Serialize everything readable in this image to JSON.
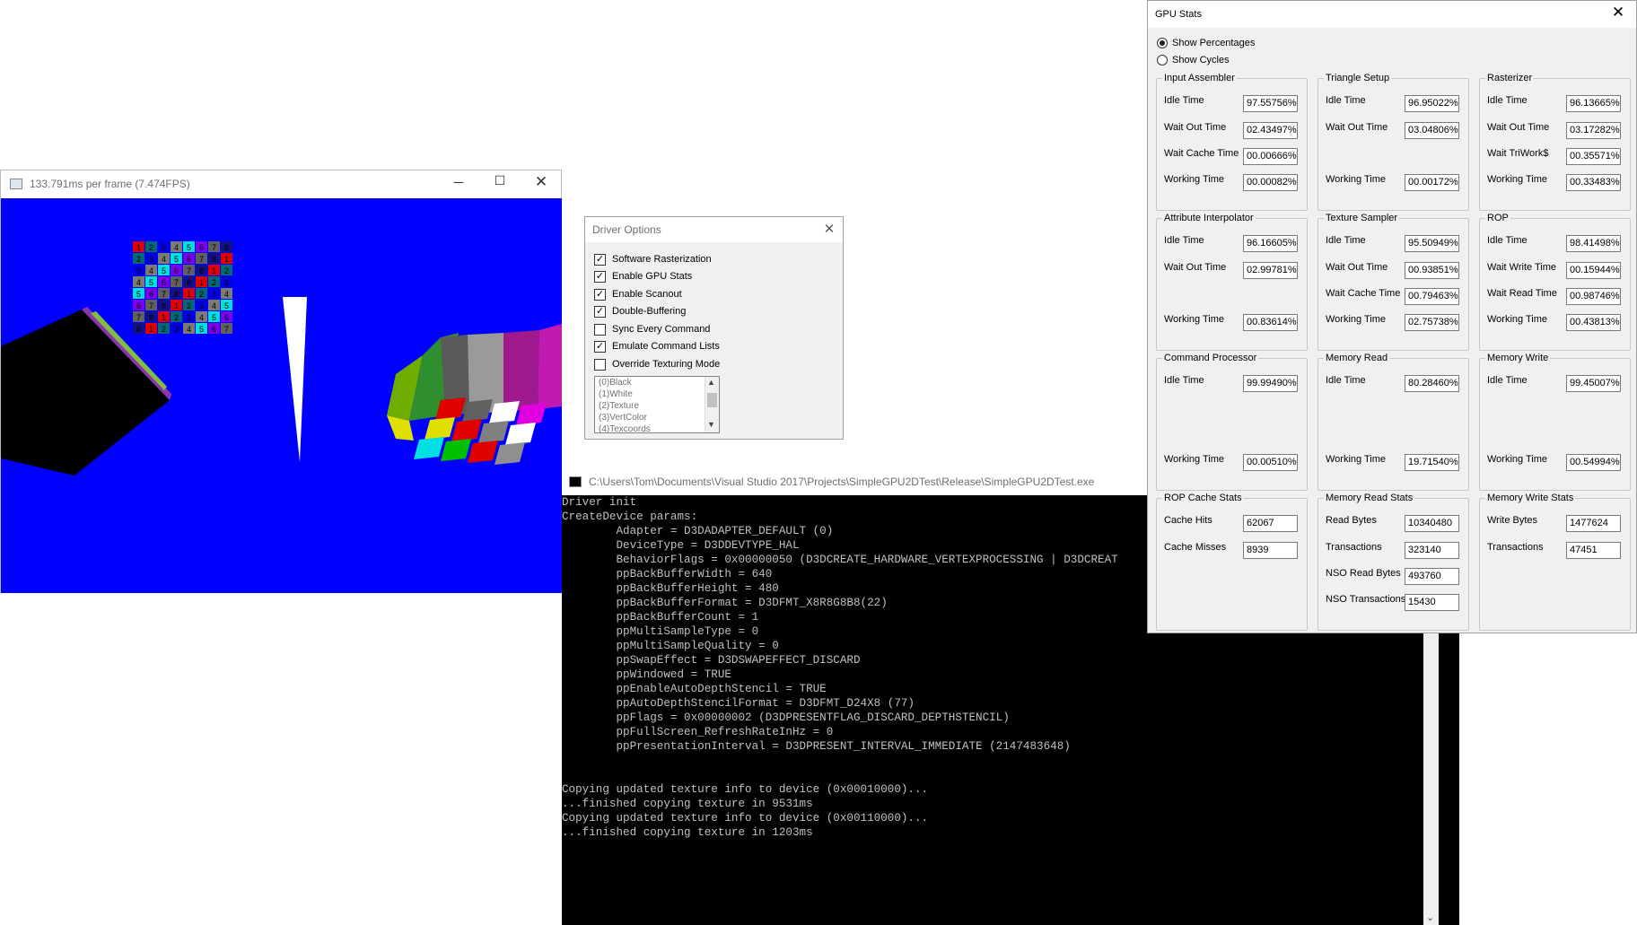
{
  "render_window": {
    "title": "133.791ms per frame (7.474FPS)",
    "checker_labels": [
      [
        "1",
        "2",
        "3",
        "4",
        "5",
        "6",
        "7",
        "8"
      ],
      [
        "2",
        "3",
        "4",
        "5",
        "6",
        "7",
        "8",
        "1"
      ],
      [
        "3",
        "4",
        "5",
        "6",
        "7",
        "8",
        "1",
        "2"
      ],
      [
        "4",
        "5",
        "6",
        "7",
        "8",
        "1",
        "2",
        "3"
      ],
      [
        "5",
        "6",
        "7",
        "8",
        "1",
        "2",
        "3",
        "4"
      ],
      [
        "6",
        "7",
        "8",
        "1",
        "2",
        "3",
        "4",
        "5"
      ],
      [
        "7",
        "8",
        "1",
        "2",
        "3",
        "4",
        "5",
        "6"
      ],
      [
        "8",
        "1",
        "2",
        "3",
        "4",
        "5",
        "6",
        "7"
      ]
    ]
  },
  "driver_options": {
    "title": "Driver Options",
    "checkboxes": [
      {
        "label": "Software Rasterization",
        "checked": true
      },
      {
        "label": "Enable GPU Stats",
        "checked": true
      },
      {
        "label": "Enable Scanout",
        "checked": true
      },
      {
        "label": "Double-Buffering",
        "checked": true
      },
      {
        "label": "Sync Every Command",
        "checked": false
      },
      {
        "label": "Emulate Command Lists",
        "checked": true
      },
      {
        "label": "Override Texturing Mode",
        "checked": false
      }
    ],
    "texturing_modes": [
      "(0)Black",
      "(1)White",
      "(2)Texture",
      "(3)VertColor",
      "(4)Texcoords"
    ]
  },
  "console": {
    "title": "C:\\Users\\Tom\\Documents\\Visual Studio 2017\\Projects\\SimpleGPU2DTest\\Release\\SimpleGPU2DTest.exe",
    "lines": [
      "Driver init",
      "CreateDevice params:",
      "        Adapter = D3DADAPTER_DEFAULT (0)",
      "        DeviceType = D3DDEVTYPE_HAL",
      "        BehaviorFlags = 0x00000050 (D3DCREATE_HARDWARE_VERTEXPROCESSING | D3DCREAT",
      "        ppBackBufferWidth = 640",
      "        ppBackBufferHeight = 480",
      "        ppBackBufferFormat = D3DFMT_X8R8G8B8(22)",
      "        ppBackBufferCount = 1",
      "        ppMultiSampleType = 0",
      "        ppMultiSampleQuality = 0",
      "        ppSwapEffect = D3DSWAPEFFECT_DISCARD",
      "        ppWindowed = TRUE",
      "        ppEnableAutoDepthStencil = TRUE",
      "        ppAutoDepthStencilFormat = D3DFMT_D24X8 (77)",
      "        ppFlags = 0x00000002 (D3DPRESENTFLAG_DISCARD_DEPTHSTENCIL)",
      "        ppFullScreen_RefreshRateInHz = 0",
      "        ppPresentationInterval = D3DPRESENT_INTERVAL_IMMEDIATE (2147483648)",
      "",
      "",
      "Copying updated texture info to device (0x00010000)...",
      "...finished copying texture in 9531ms",
      "Copying updated texture info to device (0x00110000)...",
      "...finished copying texture in 1203ms"
    ]
  },
  "gpu_stats": {
    "title": "GPU Stats",
    "radio_percent": "Show Percentages",
    "radio_cycles": "Show Cycles",
    "groups": [
      {
        "title": "Input Assembler",
        "rows": [
          {
            "label": "Idle Time",
            "value": "97.55756%"
          },
          {
            "label": "Wait Out Time",
            "value": "02.43497%"
          },
          {
            "label": "Wait Cache Time",
            "value": "00.00666%"
          },
          {
            "label": "Working Time",
            "value": "00.00082%"
          }
        ]
      },
      {
        "title": "Triangle Setup",
        "rows": [
          {
            "label": "Idle Time",
            "value": "96.95022%"
          },
          {
            "label": "Wait Out Time",
            "value": "03.04806%"
          },
          {
            "label": "Working Time",
            "value": "00.00172%"
          }
        ]
      },
      {
        "title": "Rasterizer",
        "rows": [
          {
            "label": "Idle Time",
            "value": "96.13665%"
          },
          {
            "label": "Wait Out Time",
            "value": "03.17282%"
          },
          {
            "label": "Wait TriWork$",
            "value": "00.35571%"
          },
          {
            "label": "Working Time",
            "value": "00.33483%"
          }
        ]
      },
      {
        "title": "Attribute Interpolator",
        "rows": [
          {
            "label": "Idle Time",
            "value": "96.16605%"
          },
          {
            "label": "Wait Out Time",
            "value": "02.99781%"
          },
          {
            "label": "Working Time",
            "value": "00.83614%"
          }
        ]
      },
      {
        "title": "Texture Sampler",
        "rows": [
          {
            "label": "Idle Time",
            "value": "95.50949%"
          },
          {
            "label": "Wait Out Time",
            "value": "00.93851%"
          },
          {
            "label": "Wait Cache Time",
            "value": "00.79463%"
          },
          {
            "label": "Working Time",
            "value": "02.75738%"
          }
        ]
      },
      {
        "title": "ROP",
        "rows": [
          {
            "label": "Idle Time",
            "value": "98.41498%"
          },
          {
            "label": "Wait Write Time",
            "value": "00.15944%"
          },
          {
            "label": "Wait Read Time",
            "value": "00.98746%"
          },
          {
            "label": "Working Time",
            "value": "00.43813%"
          }
        ]
      },
      {
        "title": "Command Processor",
        "rows": [
          {
            "label": "Idle Time",
            "value": "99.99490%"
          },
          {
            "label": "Working Time",
            "value": "00.00510%"
          }
        ]
      },
      {
        "title": "Memory Read",
        "rows": [
          {
            "label": "Idle Time",
            "value": "80.28460%"
          },
          {
            "label": "Working Time",
            "value": "19.71540%"
          }
        ]
      },
      {
        "title": "Memory Write",
        "rows": [
          {
            "label": "Idle Time",
            "value": "99.45007%"
          },
          {
            "label": "Working Time",
            "value": "00.54994%"
          }
        ]
      },
      {
        "title": "ROP Cache Stats",
        "rows": [
          {
            "label": "Cache Hits",
            "value": "62067"
          },
          {
            "label": "Cache Misses",
            "value": "8939"
          }
        ]
      },
      {
        "title": "Memory Read Stats",
        "rows": [
          {
            "label": "Read Bytes",
            "value": "10340480"
          },
          {
            "label": "Transactions",
            "value": "323140"
          },
          {
            "label": "NSO Read Bytes",
            "value": "493760"
          },
          {
            "label": "NSO Transactions",
            "value": "15430"
          }
        ]
      },
      {
        "title": "Memory Write Stats",
        "rows": [
          {
            "label": "Write Bytes",
            "value": "1477624"
          },
          {
            "label": "Transactions",
            "value": "47451"
          }
        ]
      }
    ]
  }
}
